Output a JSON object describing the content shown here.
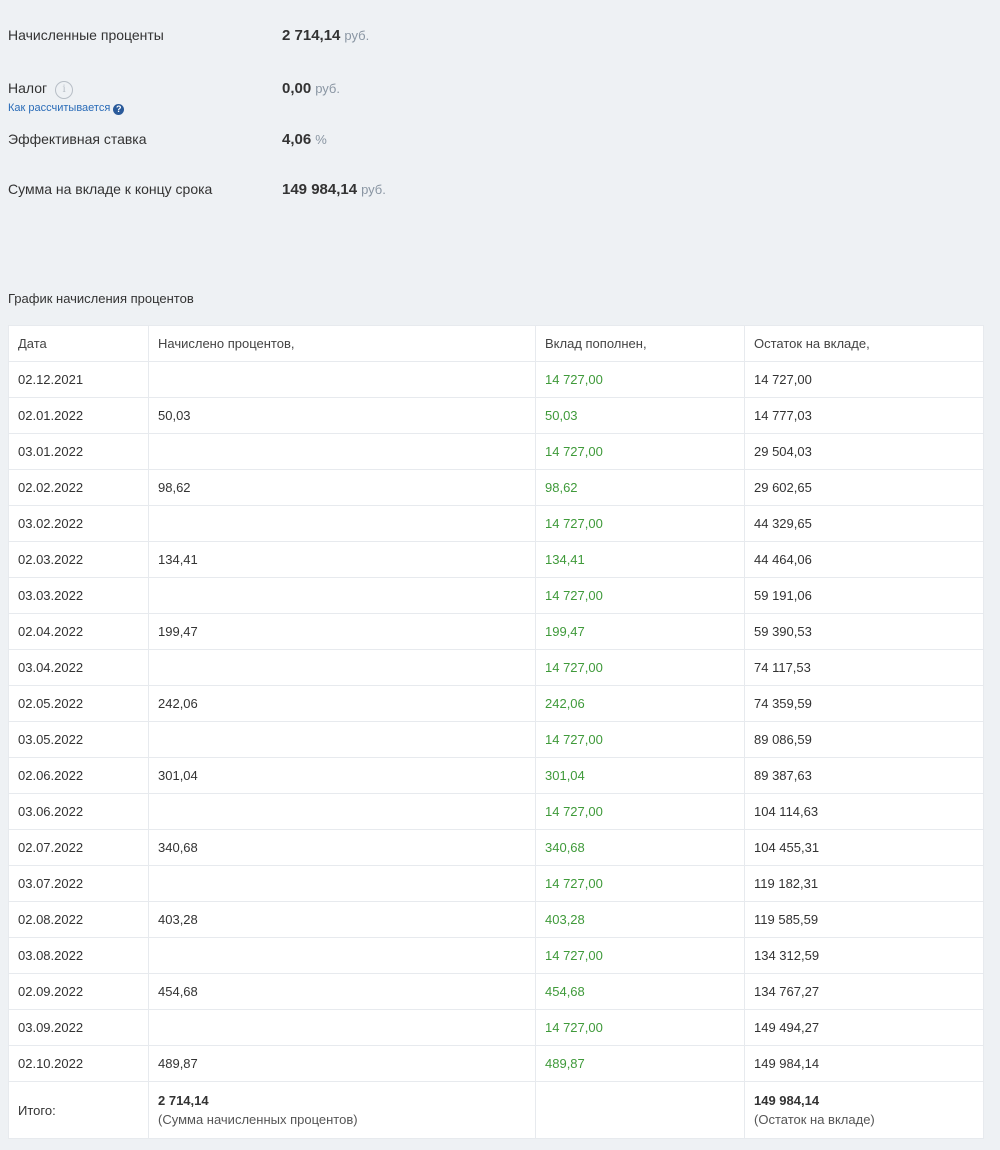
{
  "summary": {
    "interest": {
      "label": "Начисленные проценты",
      "value": "2 714,14",
      "unit": "руб."
    },
    "tax": {
      "label": "Налог",
      "info_icon": "i",
      "link": "Как рассчитывается",
      "value": "0,00",
      "unit": "руб."
    },
    "rate": {
      "label": "Эффективная ставка",
      "value": "4,06",
      "unit": "%"
    },
    "total": {
      "label": "Сумма на вкладе к концу срока",
      "value": "149 984,14",
      "unit": "руб."
    }
  },
  "schedule": {
    "title": "График начисления процентов",
    "columns": [
      "Дата",
      "Начислено процентов,",
      "Вклад пополнен,",
      "Остаток на вкладе,"
    ],
    "rows": [
      {
        "date": "02.12.2021",
        "interest": "",
        "deposit": "14 727,00",
        "balance": "14 727,00"
      },
      {
        "date": "02.01.2022",
        "interest": "50,03",
        "deposit": "50,03",
        "balance": "14 777,03"
      },
      {
        "date": "03.01.2022",
        "interest": "",
        "deposit": "14 727,00",
        "balance": "29 504,03"
      },
      {
        "date": "02.02.2022",
        "interest": "98,62",
        "deposit": "98,62",
        "balance": "29 602,65"
      },
      {
        "date": "03.02.2022",
        "interest": "",
        "deposit": "14 727,00",
        "balance": "44 329,65"
      },
      {
        "date": "02.03.2022",
        "interest": "134,41",
        "deposit": "134,41",
        "balance": "44 464,06"
      },
      {
        "date": "03.03.2022",
        "interest": "",
        "deposit": "14 727,00",
        "balance": "59 191,06"
      },
      {
        "date": "02.04.2022",
        "interest": "199,47",
        "deposit": "199,47",
        "balance": "59 390,53"
      },
      {
        "date": "03.04.2022",
        "interest": "",
        "deposit": "14 727,00",
        "balance": "74 117,53"
      },
      {
        "date": "02.05.2022",
        "interest": "242,06",
        "deposit": "242,06",
        "balance": "74 359,59"
      },
      {
        "date": "03.05.2022",
        "interest": "",
        "deposit": "14 727,00",
        "balance": "89 086,59"
      },
      {
        "date": "02.06.2022",
        "interest": "301,04",
        "deposit": "301,04",
        "balance": "89 387,63"
      },
      {
        "date": "03.06.2022",
        "interest": "",
        "deposit": "14 727,00",
        "balance": "104 114,63"
      },
      {
        "date": "02.07.2022",
        "interest": "340,68",
        "deposit": "340,68",
        "balance": "104 455,31"
      },
      {
        "date": "03.07.2022",
        "interest": "",
        "deposit": "14 727,00",
        "balance": "119 182,31"
      },
      {
        "date": "02.08.2022",
        "interest": "403,28",
        "deposit": "403,28",
        "balance": "119 585,59"
      },
      {
        "date": "03.08.2022",
        "interest": "",
        "deposit": "14 727,00",
        "balance": "134 312,59"
      },
      {
        "date": "02.09.2022",
        "interest": "454,68",
        "deposit": "454,68",
        "balance": "134 767,27"
      },
      {
        "date": "03.09.2022",
        "interest": "",
        "deposit": "14 727,00",
        "balance": "149 494,27"
      },
      {
        "date": "02.10.2022",
        "interest": "489,87",
        "deposit": "489,87",
        "balance": "149 984,14"
      }
    ],
    "totals": {
      "label": "Итого:",
      "interest": "2 714,14",
      "interest_note": "(Сумма начисленных процентов)",
      "balance": "149 984,14",
      "balance_note": "(Остаток на вкладе)"
    }
  },
  "colors": {
    "deposit_text": "#3f9a3a",
    "link": "#2a6cb8",
    "background": "#eef1f4"
  }
}
